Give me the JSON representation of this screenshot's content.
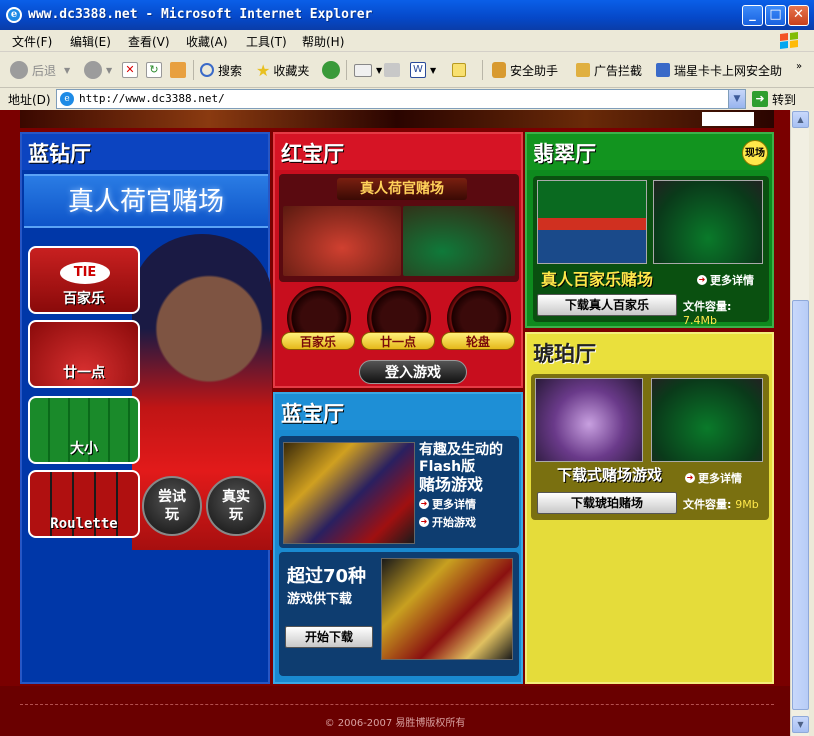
{
  "window": {
    "title": "www.dc3388.net - Microsoft Internet Explorer",
    "minimize": "_",
    "maximize": "□",
    "close": "✕"
  },
  "menu": [
    "文件(F)",
    "编辑(E)",
    "查看(V)",
    "收藏(A)",
    "工具(T)",
    "帮助(H)"
  ],
  "toolbar": {
    "back": "后退",
    "search": "搜索",
    "favorites": "收藏夹",
    "security": "安全助手",
    "adblock": "广告拦截",
    "rising": "瑞星卡卡上网安全助"
  },
  "address": {
    "label": "地址(D)",
    "url": "http://www.dc3388.net/",
    "go": "转到"
  },
  "page": {
    "blue": {
      "title": "蓝钻厅",
      "banner": "真人荷官赌场",
      "games": [
        "百家乐",
        "廿一点",
        "大小",
        "Roulette"
      ],
      "try_btn": "尝试\n玩",
      "real_btn": "真实\n玩"
    },
    "red": {
      "title": "红宝厅",
      "header": "真人荷官赌场",
      "chips": [
        "百家乐",
        "廿一点",
        "轮盘"
      ],
      "login": "登入游戏"
    },
    "cyan": {
      "title": "蓝宝厅",
      "line1": "有趣及生动的",
      "line2": "Flash版",
      "line3": "赌场游戏",
      "more": "更多详情",
      "start": "开始游戏",
      "big": "超过70种",
      "small": "游戏供下载",
      "download": "开始下载"
    },
    "green": {
      "title": "翡翠厅",
      "badge": "现场",
      "game_title": "真人百家乐赌场",
      "more": "更多详情",
      "download": "下载真人百家乐",
      "size_label": "文件容量:",
      "size_value": "7.4Mb"
    },
    "yellow": {
      "title": "琥珀厅",
      "game_title": "下载式赌场游戏",
      "more": "更多详情",
      "download": "下载琥珀赌场",
      "size_label": "文件容量:",
      "size_value": "9Mb"
    },
    "footer": "© 2006-2007 易胜博版权所有"
  },
  "colors": {
    "titlebar": "#0548C8",
    "page_bg": "#7A0000",
    "blue_hall": "#0037A8",
    "red_hall": "#C80E1E",
    "cyan_hall": "#1A8AD0",
    "green_hall": "#0E8A1E",
    "yellow_hall": "#E5DC3A"
  }
}
